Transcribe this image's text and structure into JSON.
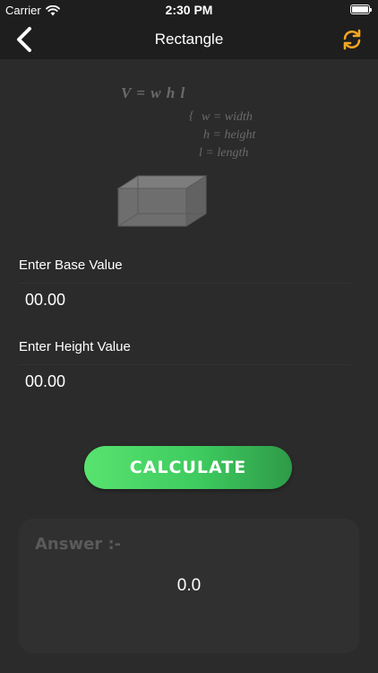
{
  "status_bar": {
    "carrier": "Carrier",
    "time": "2:30 PM",
    "wifi_icon": "wifi-icon",
    "battery_icon": "battery-icon",
    "battery_level_percent": 100
  },
  "nav": {
    "title": "Rectangle",
    "back_icon": "chevron-left-icon",
    "refresh_icon": "refresh-icon"
  },
  "formula": {
    "main": "V = w h l",
    "brace": "{",
    "w": "w = width",
    "h": "h = height",
    "l": "l = length"
  },
  "base": {
    "label": "Enter Base Value",
    "value": "00.00"
  },
  "height": {
    "label": "Enter Height Value",
    "value": "00.00"
  },
  "calculate": {
    "label": "CALCULATE"
  },
  "answer": {
    "title": "Answer :-",
    "value": "0.0"
  },
  "colors": {
    "background": "#2b2b2b",
    "bar": "#1e1e1e",
    "accent_green": "#4fd468",
    "refresh_orange": "#f5a623",
    "muted_text": "#5a5a5a"
  }
}
